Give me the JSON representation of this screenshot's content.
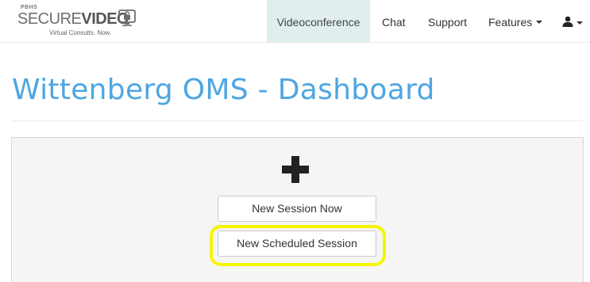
{
  "logo": {
    "top_text": "PBHS",
    "brand_part1": "SECURE",
    "brand_part2": "VIDEO",
    "tagline": "Virtual Consults. Now."
  },
  "nav": {
    "videoconference": "Videoconference",
    "chat": "Chat",
    "support": "Support",
    "features": "Features"
  },
  "page": {
    "title": "Wittenberg OMS - Dashboard"
  },
  "actions": {
    "new_session_now": "New Session Now",
    "new_scheduled_session": "New Scheduled Session"
  },
  "colors": {
    "title": "#4da6e2",
    "active_nav_bg": "#e0eeee",
    "highlight": "#f5f500"
  }
}
